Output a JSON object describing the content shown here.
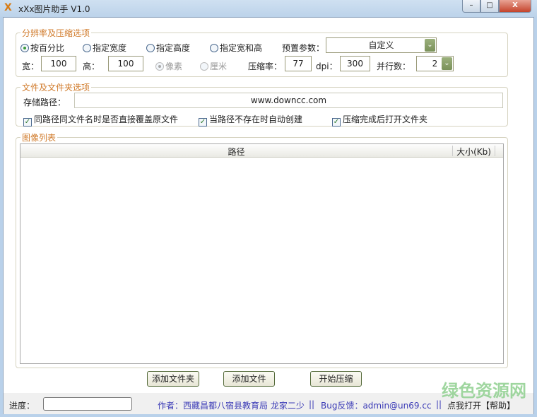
{
  "window": {
    "icon": "X",
    "title": "xXx图片助手 V1.0",
    "minimize": "–",
    "maximize": "□",
    "close": "X"
  },
  "resolution": {
    "label": "分辨率及压缩选项",
    "modes": [
      "按百分比",
      "指定宽度",
      "指定高度",
      "指定宽和高"
    ],
    "preset_label": "预置参数：",
    "preset_value": "自定义",
    "width_label": "宽：",
    "width_value": "100",
    "height_label": "高：",
    "height_value": "100",
    "units": [
      "像素",
      "厘米"
    ],
    "rate_label": "压缩率：",
    "rate_value": "77",
    "dpi_label": "dpi：",
    "dpi_value": "300",
    "parallel_label": "并行数：",
    "parallel_value": "2",
    "dropdown_glyph": "⌄"
  },
  "files": {
    "label": "文件及文件夹选项",
    "path_label": "存储路径：",
    "path_value": "www.downcc.com",
    "options": [
      "同路径同文件名时是否直接覆盖原文件",
      "当路径不存在时自动创建",
      "压缩完成后打开文件夹"
    ],
    "check_glyph": "✓"
  },
  "list": {
    "label": "图像列表",
    "columns": [
      "路径",
      "大小(Kb)"
    ]
  },
  "buttons": {
    "add_folder": "添加文件夹",
    "add_file": "添加文件",
    "start": "开始压缩"
  },
  "status": {
    "progress_label": "进度：",
    "author": "作者：西藏昌都八宿县教育局 龙家二少",
    "sep": "||",
    "bug": "Bug反馈：admin@un69.cc",
    "help": "点我打开【帮助】"
  },
  "watermark": "绿色资源网"
}
